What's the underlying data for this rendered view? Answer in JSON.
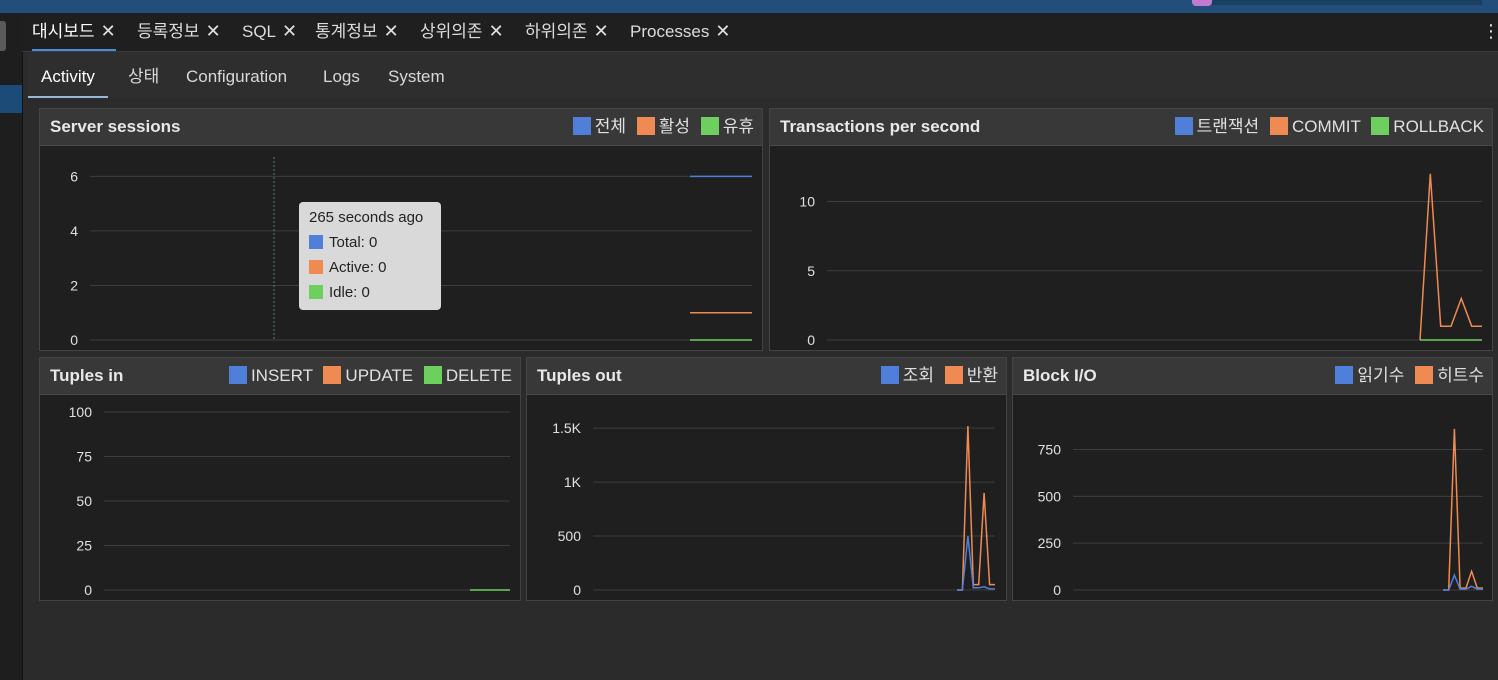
{
  "colors": {
    "blue": "#4f7fd8",
    "orange": "#ef8a52",
    "green": "#6ccf5e"
  },
  "tabs": [
    {
      "label": "대시보드"
    },
    {
      "label": "등록정보"
    },
    {
      "label": "SQL"
    },
    {
      "label": "통계정보"
    },
    {
      "label": "상위의존"
    },
    {
      "label": "하위의존"
    },
    {
      "label": "Processes"
    }
  ],
  "close_glyph": "✕",
  "menu_glyph": "⋮",
  "subtabs": [
    {
      "label": "Activity"
    },
    {
      "label": "상태"
    },
    {
      "label": "Configuration"
    },
    {
      "label": "Logs"
    },
    {
      "label": "System"
    }
  ],
  "panels": {
    "sessions": {
      "title": "Server sessions",
      "legend": [
        "전체",
        "활성",
        "유휴"
      ]
    },
    "tps": {
      "title": "Transactions per second",
      "legend": [
        "트랜잭션",
        "COMMIT",
        "ROLLBACK"
      ]
    },
    "tuples_in": {
      "title": "Tuples in",
      "legend": [
        "INSERT",
        "UPDATE",
        "DELETE"
      ]
    },
    "tuples_out": {
      "title": "Tuples out",
      "legend": [
        "조회",
        "반환"
      ]
    },
    "block_io": {
      "title": "Block I/O",
      "legend": [
        "읽기수",
        "히트수"
      ]
    }
  },
  "tooltip": {
    "title": "265 seconds ago",
    "total": "Total: 0",
    "active": "Active: 0",
    "idle": "Idle: 0"
  },
  "chart_data": [
    {
      "id": "sessions",
      "type": "line",
      "title": "Server sessions",
      "ylim": [
        0,
        6.6
      ],
      "yticks": [
        "6",
        "4",
        "2",
        "0"
      ],
      "ytick_values": [
        6,
        4,
        2,
        0
      ],
      "series": [
        {
          "name": "전체",
          "values": [
            6,
            6
          ]
        },
        {
          "name": "활성",
          "values": [
            1,
            1
          ]
        },
        {
          "name": "유휴",
          "values": [
            0,
            0
          ]
        }
      ]
    },
    {
      "id": "tps",
      "type": "line",
      "title": "Transactions per second",
      "ylim": [
        0,
        13
      ],
      "yticks": [
        "10",
        "5",
        "0"
      ],
      "ytick_values": [
        10,
        5,
        0
      ],
      "series": [
        {
          "name": "트랜잭션",
          "values": []
        },
        {
          "name": "COMMIT",
          "values": [
            0,
            12,
            1,
            1,
            3,
            1,
            1
          ]
        },
        {
          "name": "ROLLBACK",
          "values": [
            0,
            0,
            0,
            0,
            0,
            0,
            0
          ]
        }
      ]
    },
    {
      "id": "tuples_in",
      "type": "line",
      "title": "Tuples in",
      "ylim": [
        0,
        100
      ],
      "yticks": [
        "100",
        "75",
        "50",
        "25",
        "0"
      ],
      "ytick_values": [
        100,
        75,
        50,
        25,
        0
      ],
      "series": [
        {
          "name": "INSERT",
          "values": []
        },
        {
          "name": "UPDATE",
          "values": []
        },
        {
          "name": "DELETE",
          "values": [
            0,
            0
          ]
        }
      ]
    },
    {
      "id": "tuples_out",
      "type": "line",
      "title": "Tuples out",
      "ylim": [
        0,
        1650
      ],
      "yticks": [
        "1.5K",
        "1K",
        "500",
        "0"
      ],
      "ytick_values": [
        1500,
        1000,
        500,
        0
      ],
      "series": [
        {
          "name": "조회",
          "values": [
            0,
            0,
            500,
            20,
            20,
            30,
            10,
            10
          ]
        },
        {
          "name": "반환",
          "values": [
            0,
            0,
            1520,
            50,
            50,
            900,
            50,
            50
          ]
        }
      ]
    },
    {
      "id": "block_io",
      "type": "line",
      "title": "Block I/O",
      "ylim": [
        0,
        950
      ],
      "yticks": [
        "750",
        "500",
        "250",
        "0"
      ],
      "ytick_values": [
        750,
        500,
        250,
        0
      ],
      "series": [
        {
          "name": "읽기수",
          "values": [
            0,
            0,
            80,
            5,
            5,
            20,
            5,
            5
          ]
        },
        {
          "name": "히트수",
          "values": [
            0,
            0,
            860,
            10,
            10,
            100,
            10,
            10
          ]
        }
      ]
    }
  ]
}
